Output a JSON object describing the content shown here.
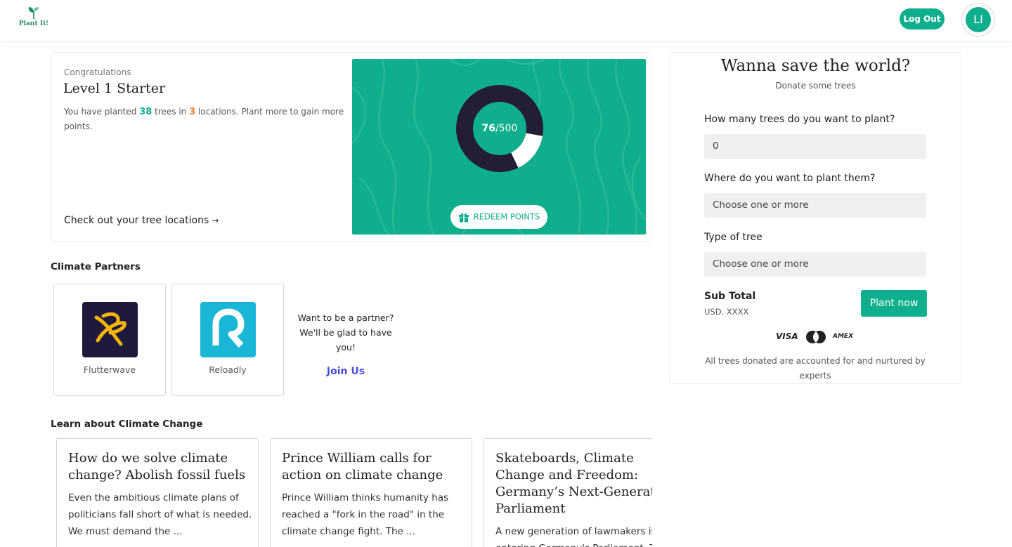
{
  "header": {
    "logo_text": "Plant It!",
    "logout_label": "Log Out",
    "avatar_initials": "LI"
  },
  "level": {
    "congrats": "Congratulations",
    "title": "Level 1 Starter",
    "planted_prefix": "You have planted",
    "trees_count": "38",
    "trees_word": "trees in",
    "locations_count": "3",
    "planted_suffix": "locations. Plant more to gain more points.",
    "tree_link": "Check out your tree locations",
    "points_current": "76",
    "points_total": "/500",
    "points_fraction": 0.152,
    "redeem_label": "REDEEM POINTS"
  },
  "partners": {
    "section_title": "Climate Partners",
    "items": [
      {
        "name": "Flutterwave"
      },
      {
        "name": "Reloadly"
      }
    ],
    "join_line1": "Want to be a partner?",
    "join_line2": "We'll be glad to have you!",
    "join_link": "Join Us"
  },
  "learn": {
    "section_title": "Learn about Climate Change",
    "articles": [
      {
        "title": "How do we solve climate change? Abolish fossil fuels",
        "excerpt": "Even the ambitious climate plans of politicians fall short of what is needed. We must demand the ..."
      },
      {
        "title": "Prince William calls for action on climate change",
        "excerpt": "Prince William thinks humanity has reached a \"fork in the road\" in the climate change fight. The ..."
      },
      {
        "title": "Skateboards, Climate Change and Freedom: Germany’s Next-Generation Parliament",
        "excerpt": "A new generation of lawmakers is entering Germany's Parliament. T..."
      }
    ]
  },
  "donate": {
    "title": "Wanna save the world?",
    "subtitle": "Donate some trees",
    "q_count": "How many trees do you want to plant?",
    "count_value": "0",
    "q_where": "Where do you want to plant them?",
    "where_placeholder": "Choose one or more",
    "q_type": "Type of tree",
    "type_placeholder": "Choose one or more",
    "subtotal_label": "Sub Total",
    "subtotal_value": "USD. XXXX",
    "plant_label": "Plant now",
    "visa": "VISA",
    "amex": "AMEX",
    "footnote": "All trees donated are accounted for and nurtured by experts"
  },
  "colors": {
    "brand_green": "#0fae8c",
    "accent_orange": "#f2822a",
    "donut_dark": "#231e33",
    "link_blue": "#4a4cdc",
    "flutterwave_bg": "#1e1a3c",
    "flutterwave_mark": "#f5b40a",
    "reloadly_bg": "#19b6d6"
  }
}
